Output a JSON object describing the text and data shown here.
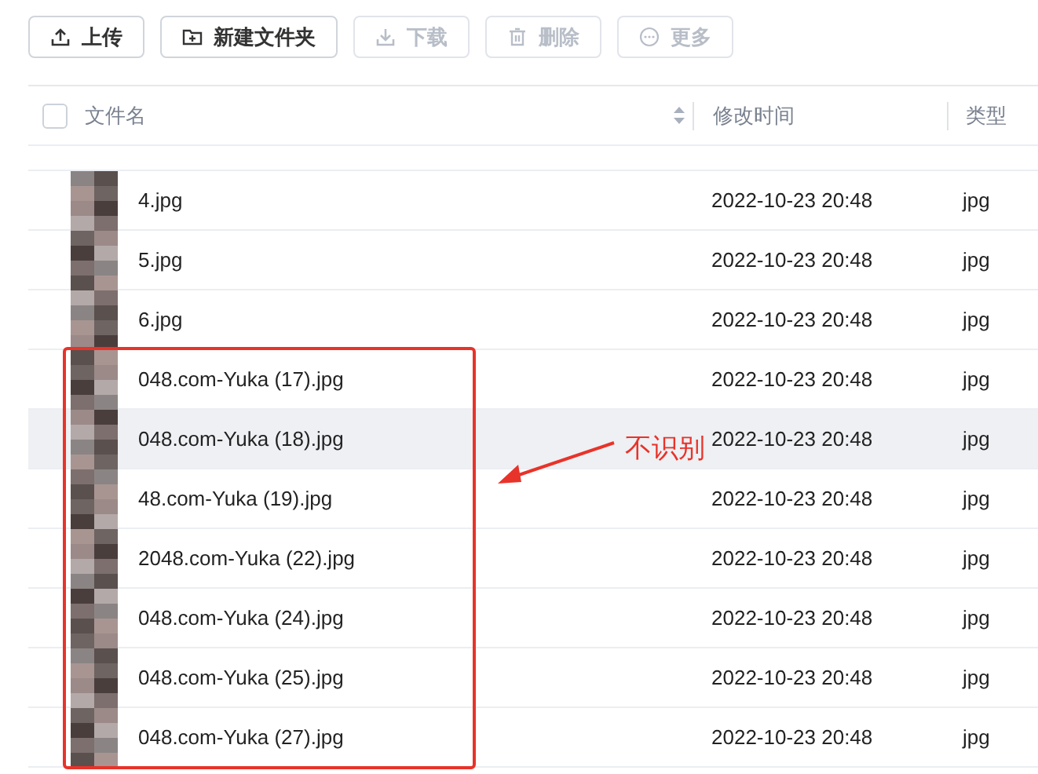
{
  "toolbar": [
    {
      "label": "上传",
      "disabled": false
    },
    {
      "label": "新建文件夹",
      "disabled": false
    },
    {
      "label": "下载",
      "disabled": true
    },
    {
      "label": "删除",
      "disabled": true
    },
    {
      "label": "更多",
      "disabled": true
    }
  ],
  "table": {
    "select_all": {
      "checked": false
    },
    "columns": [
      "文件名",
      "修改时间",
      "类型"
    ],
    "rows": [
      {
        "name": "4.jpg",
        "modified": "2022-10-23 20:48",
        "type": "jpg",
        "highlighted": false
      },
      {
        "name": "5.jpg",
        "modified": "2022-10-23 20:48",
        "type": "jpg",
        "highlighted": false
      },
      {
        "name": "6.jpg",
        "modified": "2022-10-23 20:48",
        "type": "jpg",
        "highlighted": false
      },
      {
        "name": "048.com-Yuka (17).jpg",
        "modified": "2022-10-23 20:48",
        "type": "jpg",
        "highlighted": false
      },
      {
        "name": "048.com-Yuka (18).jpg",
        "modified": "2022-10-23 20:48",
        "type": "jpg",
        "highlighted": true
      },
      {
        "name": "48.com-Yuka (19).jpg",
        "modified": "2022-10-23 20:48",
        "type": "jpg",
        "highlighted": false
      },
      {
        "name": "2048.com-Yuka (22).jpg",
        "modified": "2022-10-23 20:48",
        "type": "jpg",
        "highlighted": false
      },
      {
        "name": "048.com-Yuka (24).jpg",
        "modified": "2022-10-23 20:48",
        "type": "jpg",
        "highlighted": false
      },
      {
        "name": "048.com-Yuka (25).jpg",
        "modified": "2022-10-23 20:48",
        "type": "jpg",
        "highlighted": false
      },
      {
        "name": "048.com-Yuka (27).jpg",
        "modified": "2022-10-23 20:48",
        "type": "jpg",
        "highlighted": false
      }
    ]
  },
  "annotation": {
    "text": "不识别"
  }
}
